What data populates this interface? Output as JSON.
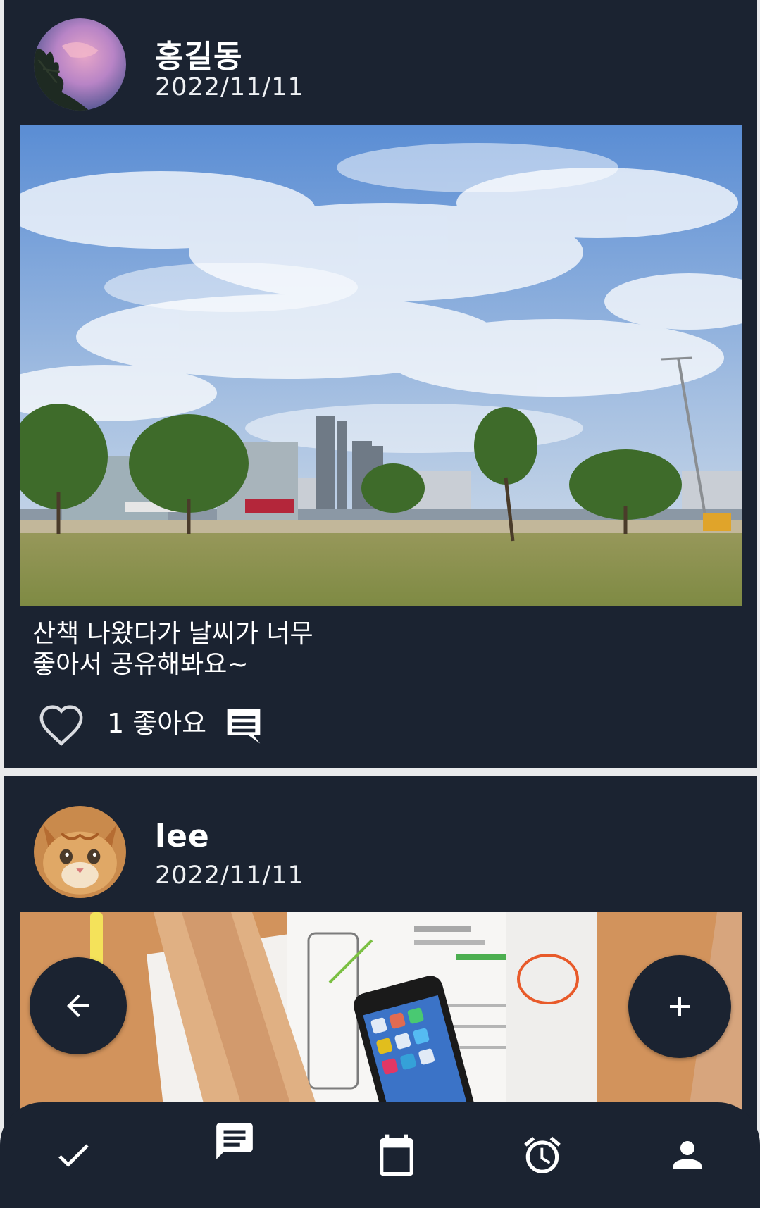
{
  "posts": [
    {
      "author": "홍길동",
      "date": "2022/11/11",
      "avatar_icon": "pink-sunset-sky-avatar",
      "photo": "riverside-park-cityscape-photo",
      "caption": "산책 나왔다가 날씨가 너무\n좋아서 공유해봐요~",
      "likes_text": "1 좋아요",
      "like_icon": "heart-outline-icon",
      "comment_icon": "comment-icon"
    },
    {
      "author": "lee",
      "date": "2022/11/11",
      "avatar_icon": "kitten-avatar",
      "photo": "desk-wireframe-smartphone-photo"
    }
  ],
  "fabs": {
    "back_icon": "arrow-left-icon",
    "add_icon": "plus-icon"
  },
  "bottom_nav": [
    {
      "icon": "check-icon"
    },
    {
      "icon": "chat-icon"
    },
    {
      "icon": "calendar-icon"
    },
    {
      "icon": "alarm-icon"
    },
    {
      "icon": "person-icon"
    }
  ],
  "colors": {
    "card_background": "#1b2331",
    "page_background": "#e9eaec",
    "text": "#ffffff"
  }
}
